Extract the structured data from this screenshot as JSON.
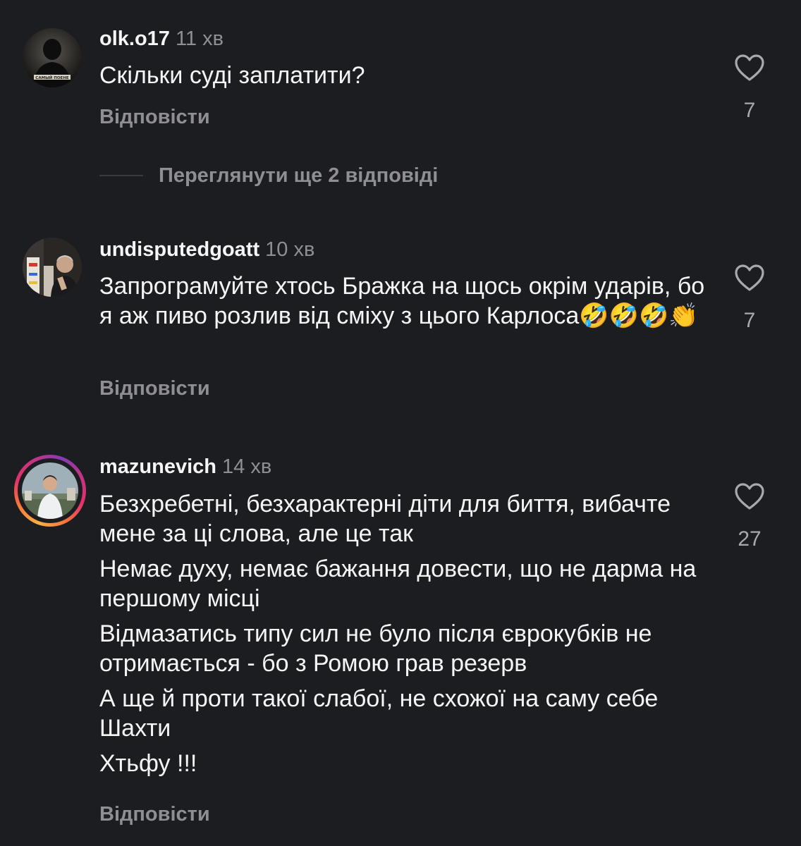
{
  "comments": [
    {
      "username": "olk.o17",
      "time": "11 хв",
      "lines": [
        "Скільки суді заплатити?"
      ],
      "reply_label": "Відповісти",
      "likes": "7",
      "avatar_caption": "САМЫЙ ПОЕНЕ",
      "view_replies": "Переглянути ще 2 відповіді"
    },
    {
      "username": "undisputedgoatt",
      "time": "10 хв",
      "lines": [
        "Запрограмуйте хтось Бражка на щось окрім ударів, бо я аж пиво розлив від сміху з цього Карлоса🤣🤣🤣👏"
      ],
      "reply_label": "Відповісти",
      "likes": "7"
    },
    {
      "username": "mazunevich",
      "time": "14 хв",
      "lines": [
        "Безхребетні, безхарактерні діти для биття, вибачте мене за ці слова, але це так",
        "Немає духу, немає бажання довести, що не дарма на першому місці",
        "Відмазатись типу сил не було після єврокубків не отримається - бо з Ромою грав резерв",
        "А ще й проти такої слабої, не схожої на саму себе Шахти",
        "Хтьфу !!!"
      ],
      "reply_label": "Відповісти",
      "likes": "27"
    }
  ],
  "colors": {
    "background": "#1c1d21",
    "text": "#f5f5f5",
    "secondary": "#8e8e93"
  }
}
